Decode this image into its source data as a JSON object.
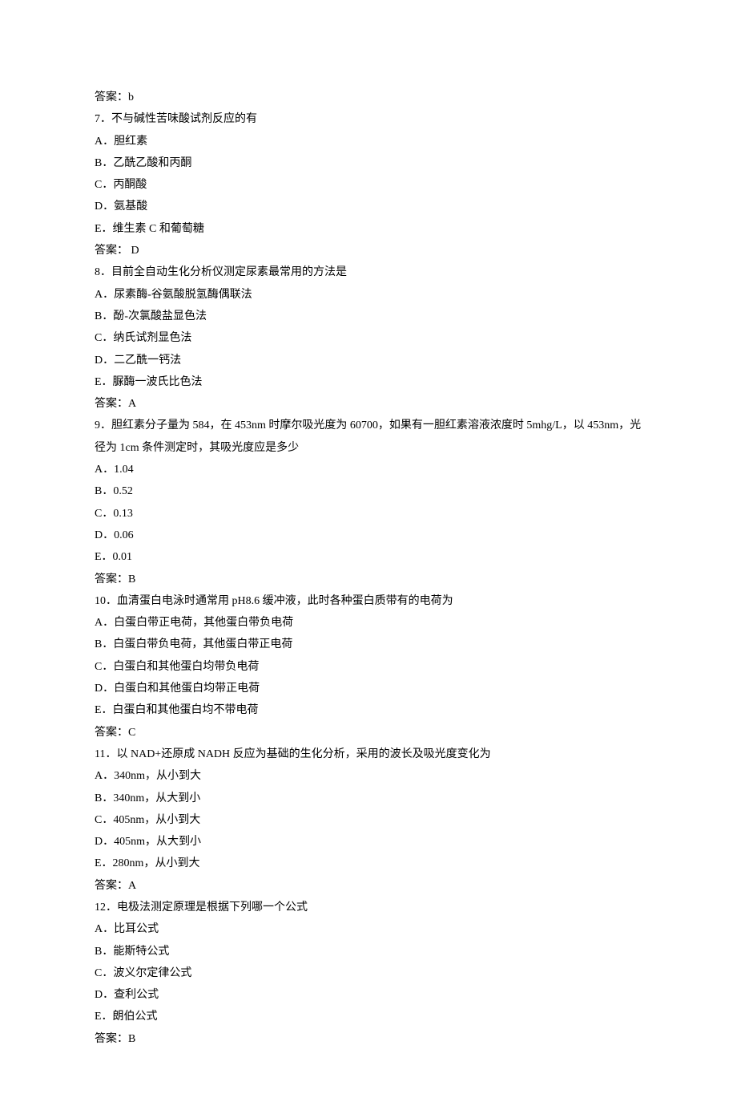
{
  "lines": [
    "答案：b",
    "7．不与碱性苦味酸试剂反应的有",
    "A．胆红素",
    "B．乙酰乙酸和丙酮",
    "C．丙酮酸",
    "D．氨基酸",
    "E．维生素 C 和葡萄糖",
    "答案： D",
    "8．目前全自动生化分析仪测定尿素最常用的方法是",
    "A．尿素酶-谷氨酸脱氢酶偶联法",
    "B．酚-次氯酸盐显色法",
    "C．纳氏试剂显色法",
    "D．二乙酰一钙法",
    "E．脲酶一波氏比色法",
    "答案：A",
    "9．胆红素分子量为 584，在 453nm 时摩尔吸光度为 60700，如果有一胆红素溶液浓度时 5mhg/L，以 453nm，光径为 1cm 条件测定时，其吸光度应是多少",
    "A．1.04",
    "B．0.52",
    "C．0.13",
    "D．0.06",
    "E．0.01",
    "答案：B",
    "10．血清蛋白电泳时通常用 pH8.6 缓冲液，此时各种蛋白质带有的电荷为",
    "A．白蛋白带正电荷，其他蛋白带负电荷",
    "B．白蛋白带负电荷，其他蛋白带正电荷",
    "C．白蛋白和其他蛋白均带负电荷",
    "D．白蛋白和其他蛋白均带正电荷",
    "E．白蛋白和其他蛋白均不带电荷",
    "答案：C",
    "11．以 NAD+还原成 NADH 反应为基础的生化分析，采用的波长及吸光度变化为",
    "A．340nm，从小到大",
    "B．340nm，从大到小",
    "C．405nm，从小到大",
    "D．405nm，从大到小",
    "E．280nm，从小到大",
    "答案：A",
    "12．电极法测定原理是根据下列哪一个公式",
    "A．比耳公式",
    "B．能斯特公式",
    "C．波义尔定律公式",
    "D．查利公式",
    "E．朗伯公式",
    "答案：B"
  ]
}
